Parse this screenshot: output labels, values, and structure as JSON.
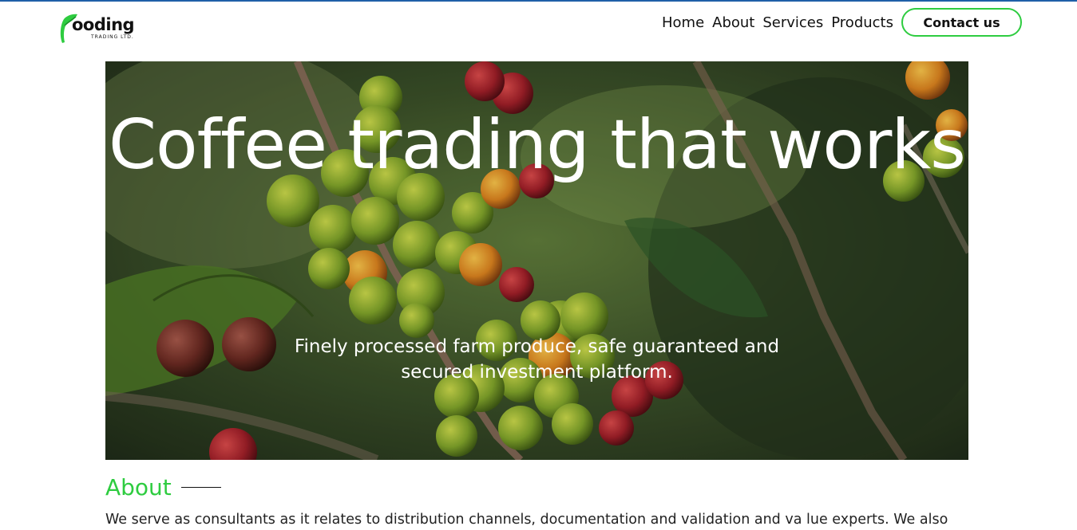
{
  "brand": {
    "name": "ooding",
    "tagline": "TRADING LTD."
  },
  "nav": {
    "items": [
      "Home",
      "About",
      "Services",
      "Products"
    ],
    "contact_label": "Contact us"
  },
  "hero": {
    "title": "Coffee trading that works",
    "subtitle": "Finely processed farm produce, safe guaranteed and secured investment platform."
  },
  "about": {
    "heading": "About",
    "text": "We serve as consultants as it relates to distribution channels, documentation and validation and va lue experts. We also"
  },
  "colors": {
    "accent": "#2ecc40",
    "topline": "#1f5fa8"
  }
}
